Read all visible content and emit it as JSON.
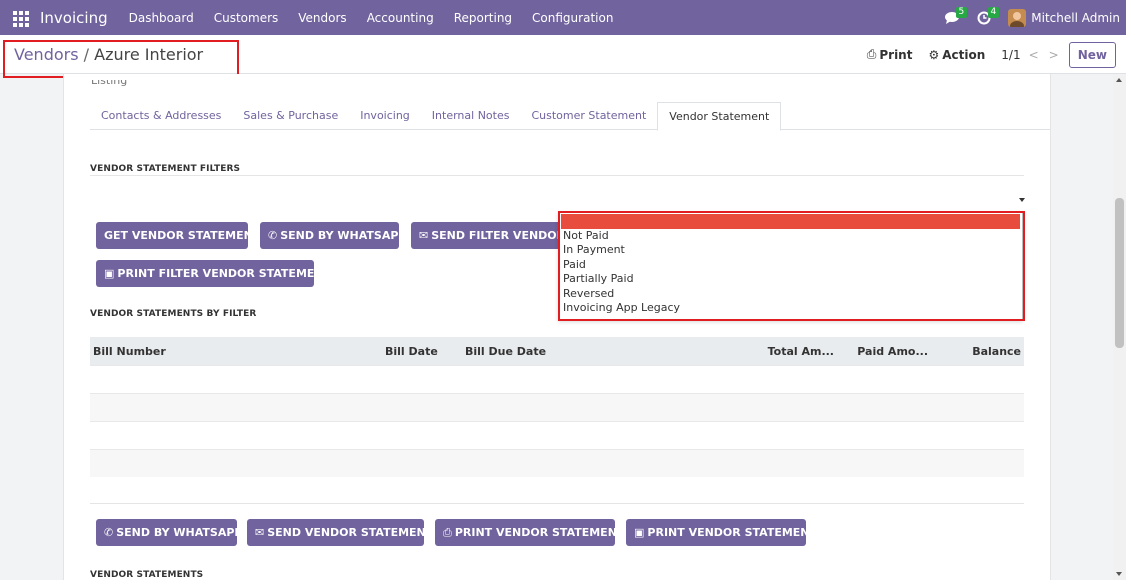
{
  "navbar": {
    "app_name": "Invoicing",
    "menu": [
      "Dashboard",
      "Customers",
      "Vendors",
      "Accounting",
      "Reporting",
      "Configuration"
    ],
    "messages_badge": "5",
    "activities_badge": "4",
    "user_name": "Mitchell Admin"
  },
  "breadcrumb": {
    "parent": "Vendors",
    "separator": "/",
    "current": "Azure Interior"
  },
  "control_panel": {
    "print_label": "Print",
    "action_label": "Action",
    "pager": "1/1",
    "new_label": "New"
  },
  "sheet": {
    "cut_off_label": "Listing",
    "tabs": [
      {
        "label": "Contacts & Addresses",
        "active": false
      },
      {
        "label": "Sales & Purchase",
        "active": false
      },
      {
        "label": "Invoicing",
        "active": false
      },
      {
        "label": "Internal Notes",
        "active": false
      },
      {
        "label": "Customer Statement",
        "active": false
      },
      {
        "label": "Vendor Statement",
        "active": true
      }
    ],
    "filters_title": "VENDOR STATEMENT FILTERS",
    "buttons": {
      "get_statement": "GET VENDOR STATEMENT",
      "send_whatsapp": "SEND BY WHATSAPP",
      "send_filter": "SEND FILTER VENDOR STATEMENT",
      "print_filter": "PRINT FILTER VENDOR STATEMENT"
    },
    "by_filter_title": "VENDOR STATEMENTS BY FILTER",
    "table": {
      "columns": [
        "Bill Number",
        "Bill Date",
        "Bill Due Date",
        "Total Am...",
        "Paid Amo...",
        "Balance"
      ]
    },
    "bottom_buttons": {
      "send_whatsapp": "SEND BY WHATSAPP",
      "send_statement": "SEND VENDOR STATEMENT",
      "print_statement": "PRINT VENDOR STATEMENT",
      "print_statement_2": "PRINT VENDOR STATEMENT"
    },
    "statements_title": "VENDOR STATEMENTS"
  },
  "dropdown": {
    "options": [
      "Not Paid",
      "In Payment",
      "Paid",
      "Partially Paid",
      "Reversed",
      "Invoicing App Legacy"
    ]
  },
  "colors": {
    "brand": "#71639e",
    "highlight": "#e11d21",
    "selected_option": "#e74c3c",
    "badge": "#28a745"
  }
}
